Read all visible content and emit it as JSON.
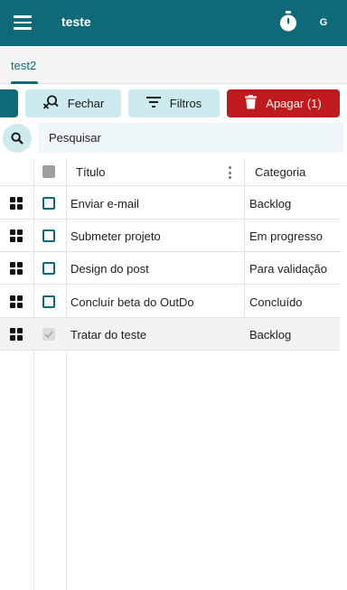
{
  "appbar": {
    "title": "teste",
    "avatar_initial": "G"
  },
  "tabs": [
    {
      "label": "test2",
      "active": true
    }
  ],
  "toolbar": {
    "close_label": "Fechar",
    "filters_label": "Filtros",
    "delete_label": "Apagar (1)"
  },
  "search": {
    "placeholder": "Pesquisar",
    "value": ""
  },
  "table": {
    "columns": {
      "title": "Título",
      "category": "Categoria"
    },
    "rows": [
      {
        "title": "Enviar e-mail",
        "category": "Backlog",
        "checked": false
      },
      {
        "title": "Submeter projeto",
        "category": "Em progresso",
        "checked": false
      },
      {
        "title": "Design do post",
        "category": "Para validação",
        "checked": false
      },
      {
        "title": "Concluír beta do OutDo",
        "category": "Concluído",
        "checked": false
      },
      {
        "title": "Tratar do teste",
        "category": "Backlog",
        "checked": true
      }
    ]
  },
  "colors": {
    "primary": "#0e6a78",
    "accent_light": "#cdeaef",
    "danger": "#c0191e"
  },
  "icons": [
    "menu-icon",
    "timer-icon",
    "search-close-icon",
    "filter-icon",
    "trash-icon",
    "search-icon",
    "kebab-icon",
    "drag-grid-icon"
  ]
}
